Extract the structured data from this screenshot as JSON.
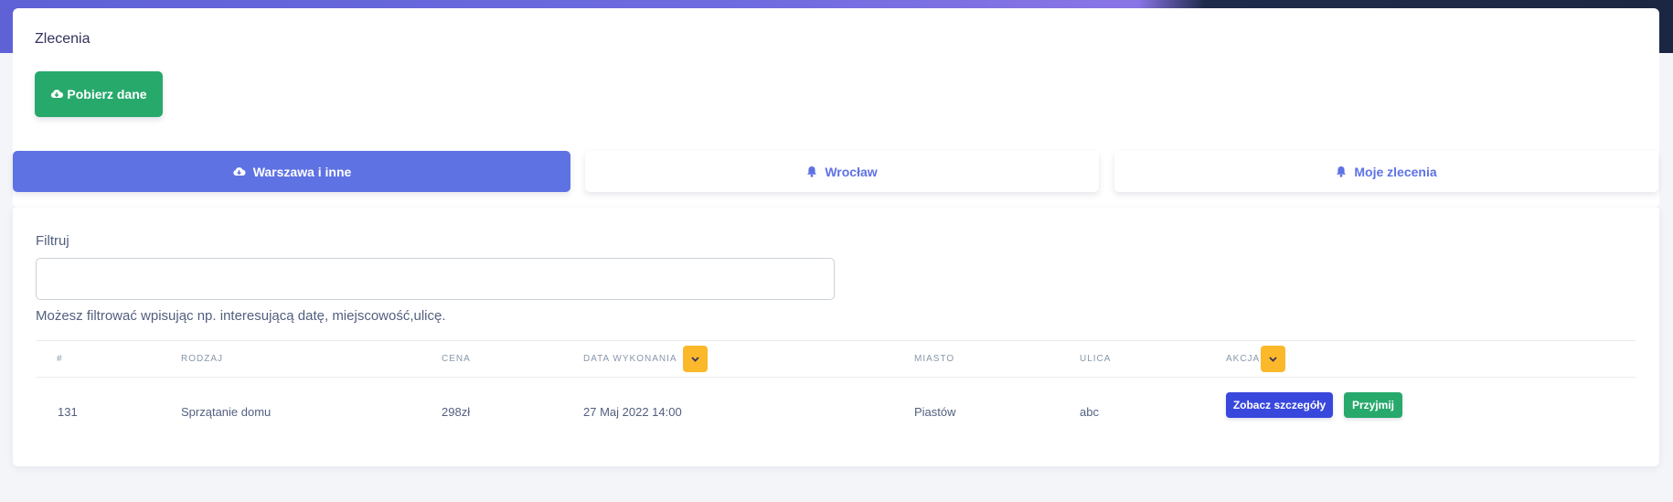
{
  "header": {
    "title": "Zlecenia"
  },
  "actions": {
    "download_label": "Pobierz dane",
    "download_icon": "cloud-download-icon"
  },
  "tabs": [
    {
      "label": "Warszawa i inne",
      "icon": "cloud-download-icon",
      "active": true
    },
    {
      "label": "Wrocław",
      "icon": "bell-icon",
      "active": false
    },
    {
      "label": "Moje zlecenia",
      "icon": "bell-icon",
      "active": false
    }
  ],
  "filter": {
    "label": "Filtruj",
    "value": "",
    "placeholder": "",
    "help": "Możesz filtrować wpisując np. interesującą datę, miejscowość,ulicę."
  },
  "table": {
    "columns": [
      "#",
      "Rodzaj",
      "Cena",
      "Data wykonania",
      "Miasto",
      "Ulica",
      "Akcja"
    ],
    "rows": [
      {
        "id": "131",
        "type": "Sprzątanie domu",
        "price": "298zł",
        "date": "27 Maj 2022 14:00",
        "city": "Piastów",
        "street": "abc",
        "details_label": "Zobacz szczegóły",
        "accept_label": "Przyjmij"
      }
    ]
  },
  "colors": {
    "primary": "#5e72e4",
    "success": "#27a96c",
    "warning": "#fbb82b",
    "details_button": "#3848dc"
  }
}
